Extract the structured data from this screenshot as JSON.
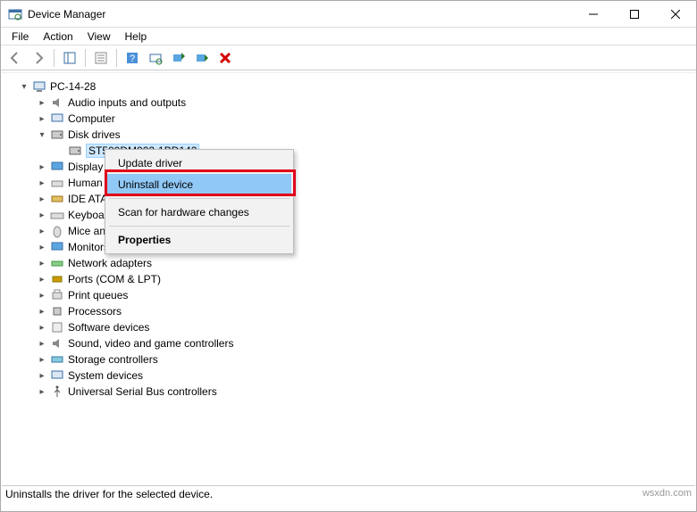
{
  "window": {
    "title": "Device Manager"
  },
  "menu": {
    "file": "File",
    "action": "Action",
    "view": "View",
    "help": "Help"
  },
  "status": {
    "text": "Uninstalls the driver for the selected device.",
    "watermark": "wsxdn.com"
  },
  "tree": {
    "root": "PC-14-28",
    "audio": "Audio inputs and outputs",
    "computer": "Computer",
    "disk": "Disk drives",
    "disk_child": "ST500DM002-1BD142",
    "display": "Display",
    "human": "Human",
    "ide": "IDE ATA",
    "keyboard": "Keyboa",
    "mice": "Mice an",
    "monitors": "Monitors",
    "network": "Network adapters",
    "ports": "Ports (COM & LPT)",
    "printq": "Print queues",
    "processors": "Processors",
    "software": "Software devices",
    "sound": "Sound, video and game controllers",
    "storage": "Storage controllers",
    "system": "System devices",
    "usb": "Universal Serial Bus controllers"
  },
  "context": {
    "update": "Update driver",
    "uninstall": "Uninstall device",
    "scan": "Scan for hardware changes",
    "properties": "Properties"
  }
}
